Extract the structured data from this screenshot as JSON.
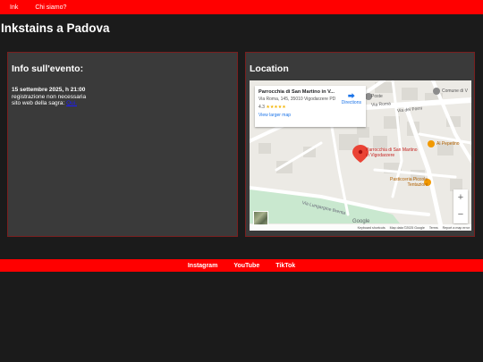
{
  "nav": {
    "items": [
      {
        "label": "Ink"
      },
      {
        "label": "Chi siamo?"
      }
    ]
  },
  "page": {
    "title": "Inkstains a Padova"
  },
  "info": {
    "heading": "Info sull'evento:",
    "date": "15 settembre 2025, h 21:00",
    "registration": "registrazione non necessaria",
    "website_prefix": "sito web della sagra:",
    "website_link": "Qui."
  },
  "location": {
    "heading": "Location",
    "map": {
      "place_name": "Parrocchia di San Martino in V...",
      "address": "Via Roma, 145, 35010 Vigodarzere PD",
      "rating": "4.3",
      "stars": "★★★★★",
      "larger_map": "View larger map",
      "directions": "Directions",
      "pin_label": "Parrocchia di San Martino in Vigodarzere",
      "poi_1": "Al Pepetino",
      "poi_2": "Pasticceria Piccole Tentazioni",
      "poi_3": "Comune di V",
      "poi_4": "Poste",
      "street_1": "Via Roma",
      "street_2": "Via Lungargine Brenta",
      "street_3": "Via dei Forni",
      "zoom_in": "+",
      "zoom_out": "−",
      "google": "Google",
      "attribution": [
        "Keyboard shortcuts",
        "Map data ©2025 Google",
        "Terms",
        "Report a map error"
      ]
    }
  },
  "footer": {
    "links": [
      {
        "label": "Instagram"
      },
      {
        "label": "YouTube"
      },
      {
        "label": "TikTok"
      }
    ]
  },
  "colors": {
    "brand_red": "#ff0000",
    "background": "#1b1b1b",
    "card": "#3a3a3a",
    "link": "#1a1aff"
  }
}
